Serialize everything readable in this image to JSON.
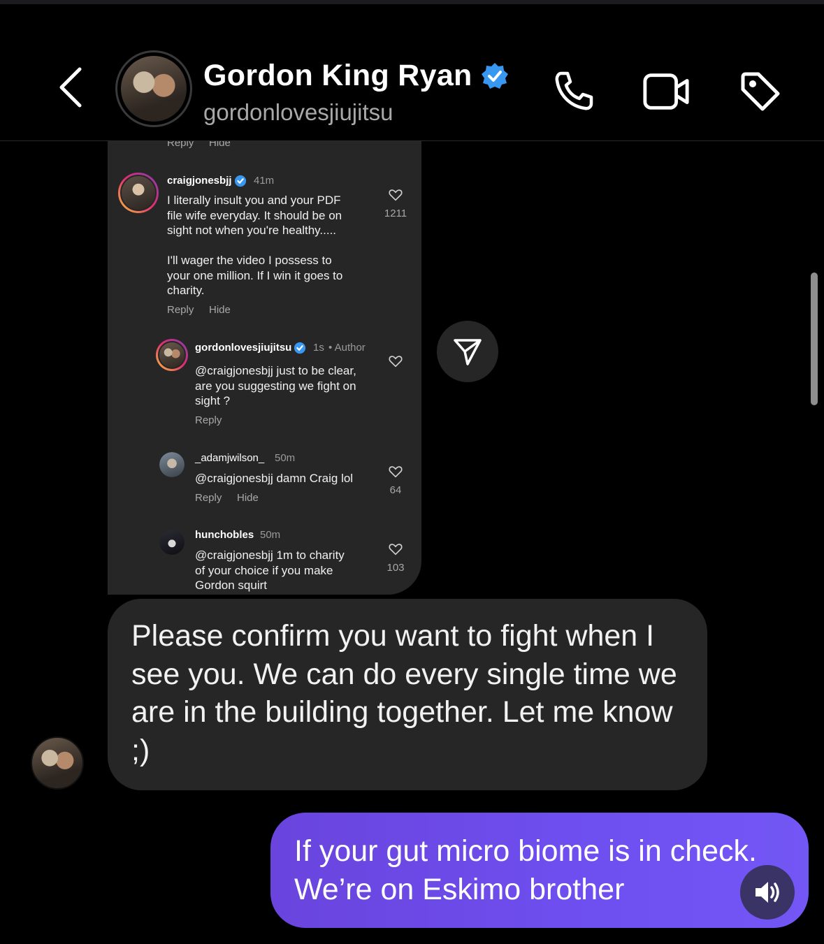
{
  "header": {
    "name": "Gordon King Ryan",
    "handle": "gordonlovesjiujitsu",
    "icons": [
      "back-chevron-icon",
      "phone-icon",
      "video-camera-icon",
      "tag-icon"
    ]
  },
  "post": {
    "top_actions": {
      "reply": "Reply",
      "hide": "Hide"
    },
    "comments": [
      {
        "user": "craigjonesbjj",
        "time": "41m",
        "text": "I literally insult you and your PDF\nfile wife everyday. It should be on\nsight not when you're healthy.....\n\nI'll wager the video I possess to\nyour one million. If I win it goes to\ncharity.",
        "likes": "1211",
        "reply": "Reply",
        "hide": "Hide"
      },
      {
        "user": "gordonlovesjiujitsu",
        "time": "1s",
        "author_tag": "• Author",
        "text": "@craigjonesbjj just to be clear,\nare you suggesting we fight on\nsight ?",
        "reply": "Reply"
      },
      {
        "user": "_adamjwilson_",
        "time": "50m",
        "text": "@craigjonesbjj damn Craig lol",
        "likes": "64",
        "reply": "Reply",
        "hide": "Hide"
      },
      {
        "user": "hunchobles",
        "time": "50m",
        "text": "@craigjonesbjj 1m to charity\nof your choice if you make\nGordon squirt",
        "likes": "103"
      }
    ]
  },
  "messages": {
    "incoming": "Please confirm you want to fight when I see you. We can do every single time we are in the building together. Let me know ;)",
    "outgoing": "If your gut micro biome is in check. We’re on Eskimo brother"
  },
  "colors": {
    "background": "#000000",
    "bubble_in": "#262626",
    "bubble_out": "#6e4ff0",
    "verified": "#3897f0"
  }
}
